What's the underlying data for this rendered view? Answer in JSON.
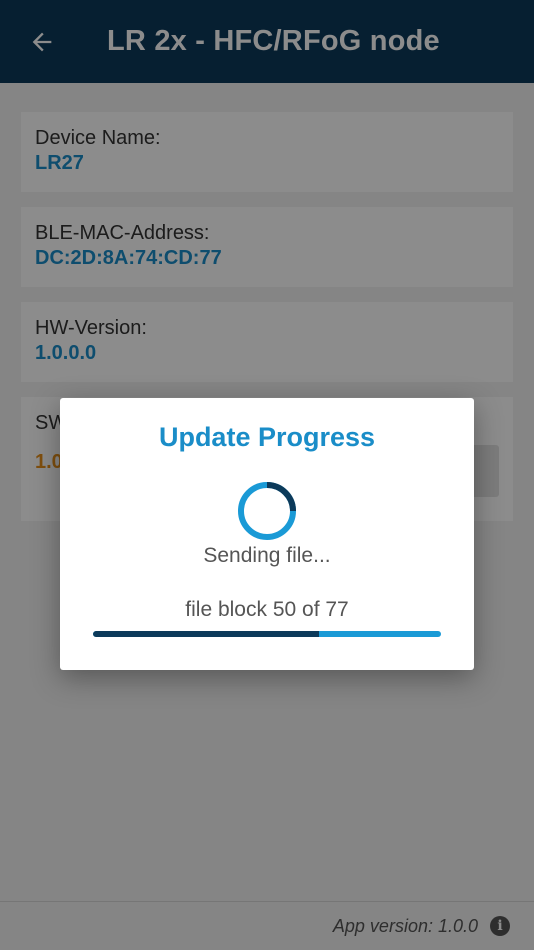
{
  "appbar": {
    "title": "LR 2x - HFC/RFoG node",
    "back_icon": "arrow-left-icon"
  },
  "cards": [
    {
      "label": "Device Name:",
      "value": "LR27"
    },
    {
      "label": "BLE-MAC-Address:",
      "value": "DC:2D:8A:74:CD:77"
    },
    {
      "label": "HW-Version:",
      "value": "1.0.0.0"
    },
    {
      "label": "SW",
      "value": "1.0"
    }
  ],
  "footer": {
    "app_version": "App version: 1.0.0",
    "info_icon": "info-icon"
  },
  "dialog": {
    "title": "Update Progress",
    "status": "Sending file...",
    "block_text": "file block 50 of 77",
    "progress": {
      "current": 50,
      "total": 77
    }
  },
  "colors": {
    "appbar": "#0c3a5a",
    "accent": "#1a8dc8",
    "sw_value": "#e8901a",
    "progress_fill": "#0c3a5a",
    "progress_track": "#1a9ad6"
  }
}
